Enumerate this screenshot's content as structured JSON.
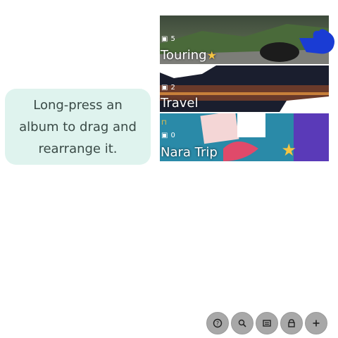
{
  "tip": {
    "text": "Long-press an album to drag and rearrange it."
  },
  "albums": [
    {
      "title": "Touring",
      "count": "5",
      "starred": true,
      "locked": false
    },
    {
      "title": "Travel",
      "count": "2",
      "starred": false,
      "locked": false
    },
    {
      "title": "Nara Trip",
      "count": "0",
      "starred": true,
      "locked": true
    }
  ],
  "toolbar": {
    "buttons": [
      "help-icon",
      "search-icon",
      "layout-icon",
      "lock-icon",
      "add-icon"
    ]
  },
  "colors": {
    "accent": "#1a3cd4",
    "tip_bg": "#dff3ee",
    "fab": "#a8a8a8"
  }
}
